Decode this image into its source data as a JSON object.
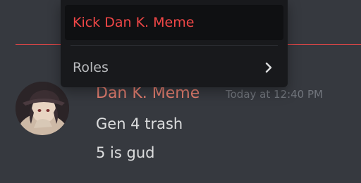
{
  "context_menu": {
    "kick_label": "Kick Dan K. Meme",
    "roles_label": "Roles",
    "roles_icon": "chevron-right-icon"
  },
  "message": {
    "author": "Dan K. Meme",
    "timestamp": "Today at 12:40 PM",
    "lines": [
      "Gen 4 trash",
      "5 is gud"
    ]
  },
  "colors": {
    "background": "#36393f",
    "menu_background": "#18191c",
    "danger": "#f04747",
    "author_color": "#e67f71",
    "text": "#dcddde",
    "muted": "#72767d"
  }
}
